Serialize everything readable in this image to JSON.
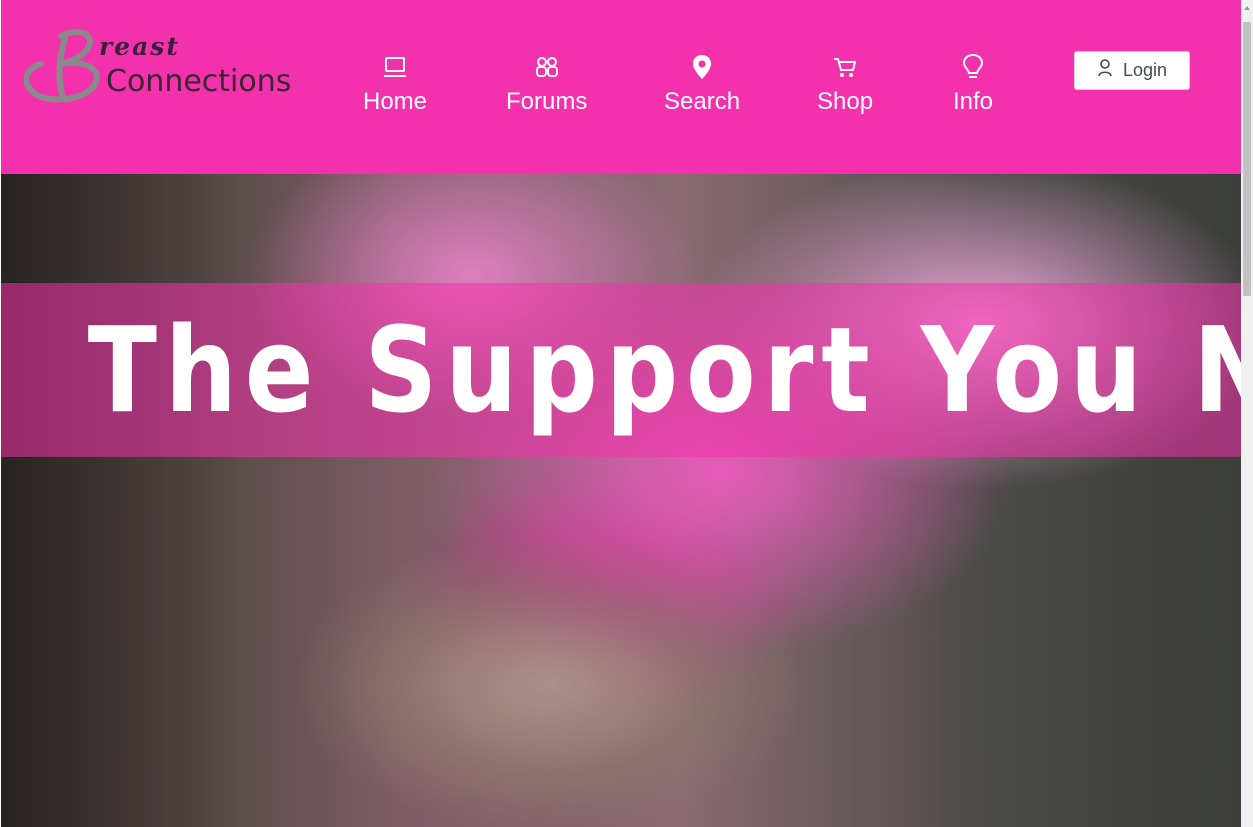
{
  "logo": {
    "top_text": "reast",
    "main_text": "Connections",
    "letter": "B"
  },
  "nav": [
    {
      "id": "home",
      "label": "Home",
      "icon": "laptop-icon"
    },
    {
      "id": "forums",
      "label": "Forums",
      "icon": "people-icon"
    },
    {
      "id": "search",
      "label": "Search",
      "icon": "map-pin-icon"
    },
    {
      "id": "shop",
      "label": "Shop",
      "icon": "cart-icon"
    },
    {
      "id": "info",
      "label": "Info",
      "icon": "lightbulb-icon"
    }
  ],
  "login": {
    "label": "Login",
    "icon": "user-icon"
  },
  "hero": {
    "title": "The Support You Need"
  },
  "colors": {
    "brand_pink": "#f431ac",
    "white": "#ffffff",
    "logo_text": "#3c2433"
  }
}
